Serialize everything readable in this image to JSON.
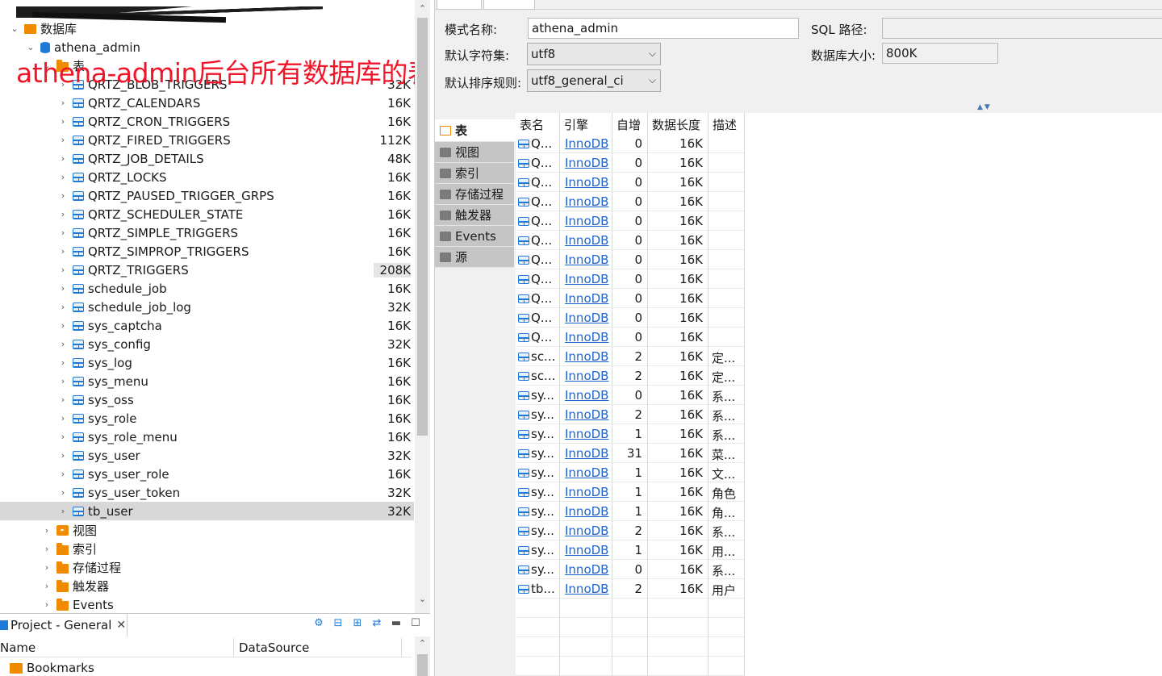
{
  "tree": {
    "root_label": "数据库",
    "schema_label": "athena_admin",
    "tables_folder_label": "表",
    "tables": [
      {
        "name": "QRTZ_BLOB_TRIGGERS",
        "size": "32K"
      },
      {
        "name": "QRTZ_CALENDARS",
        "size": "16K"
      },
      {
        "name": "QRTZ_CRON_TRIGGERS",
        "size": "16K"
      },
      {
        "name": "QRTZ_FIRED_TRIGGERS",
        "size": "112K"
      },
      {
        "name": "QRTZ_JOB_DETAILS",
        "size": "48K"
      },
      {
        "name": "QRTZ_LOCKS",
        "size": "16K"
      },
      {
        "name": "QRTZ_PAUSED_TRIGGER_GRPS",
        "size": "16K"
      },
      {
        "name": "QRTZ_SCHEDULER_STATE",
        "size": "16K"
      },
      {
        "name": "QRTZ_SIMPLE_TRIGGERS",
        "size": "16K"
      },
      {
        "name": "QRTZ_SIMPROP_TRIGGERS",
        "size": "16K"
      },
      {
        "name": "QRTZ_TRIGGERS",
        "size": "208K"
      },
      {
        "name": "schedule_job",
        "size": "16K"
      },
      {
        "name": "schedule_job_log",
        "size": "32K"
      },
      {
        "name": "sys_captcha",
        "size": "16K"
      },
      {
        "name": "sys_config",
        "size": "32K"
      },
      {
        "name": "sys_log",
        "size": "16K"
      },
      {
        "name": "sys_menu",
        "size": "16K"
      },
      {
        "name": "sys_oss",
        "size": "16K"
      },
      {
        "name": "sys_role",
        "size": "16K"
      },
      {
        "name": "sys_role_menu",
        "size": "16K"
      },
      {
        "name": "sys_user",
        "size": "32K"
      },
      {
        "name": "sys_user_role",
        "size": "16K"
      },
      {
        "name": "sys_user_token",
        "size": "32K"
      },
      {
        "name": "tb_user",
        "size": "32K"
      }
    ],
    "other_folders": [
      "视图",
      "索引",
      "存储过程",
      "触发器",
      "Events"
    ]
  },
  "annotation": "athena-admin后台所有数据库的表",
  "project_panel": {
    "tab_label": "Project - General",
    "col_name": "Name",
    "col_datasource": "DataSource",
    "row_bookmarks": "Bookmarks"
  },
  "properties": {
    "schema_name_label": "模式名称:",
    "schema_name_value": "athena_admin",
    "sql_path_label": "SQL 路径:",
    "sql_path_value": "",
    "charset_label": "默认字符集:",
    "charset_value": "utf8",
    "db_size_label": "数据库大小:",
    "db_size_value": "800K",
    "collation_label": "默认排序规则:",
    "collation_value": "utf8_general_ci"
  },
  "vtabs": [
    "表",
    "视图",
    "索引",
    "存储过程",
    "触发器",
    "Events",
    "源"
  ],
  "table_grid": {
    "headers": [
      "表名",
      "引擎",
      "自增",
      "数据长度",
      "描述"
    ],
    "rows": [
      {
        "name": "Q...",
        "engine": "InnoDB",
        "auto": "0",
        "len": "16K",
        "desc": ""
      },
      {
        "name": "Q...",
        "engine": "InnoDB",
        "auto": "0",
        "len": "16K",
        "desc": ""
      },
      {
        "name": "Q...",
        "engine": "InnoDB",
        "auto": "0",
        "len": "16K",
        "desc": ""
      },
      {
        "name": "Q...",
        "engine": "InnoDB",
        "auto": "0",
        "len": "16K",
        "desc": ""
      },
      {
        "name": "Q...",
        "engine": "InnoDB",
        "auto": "0",
        "len": "16K",
        "desc": ""
      },
      {
        "name": "Q...",
        "engine": "InnoDB",
        "auto": "0",
        "len": "16K",
        "desc": ""
      },
      {
        "name": "Q...",
        "engine": "InnoDB",
        "auto": "0",
        "len": "16K",
        "desc": ""
      },
      {
        "name": "Q...",
        "engine": "InnoDB",
        "auto": "0",
        "len": "16K",
        "desc": ""
      },
      {
        "name": "Q...",
        "engine": "InnoDB",
        "auto": "0",
        "len": "16K",
        "desc": ""
      },
      {
        "name": "Q...",
        "engine": "InnoDB",
        "auto": "0",
        "len": "16K",
        "desc": ""
      },
      {
        "name": "Q...",
        "engine": "InnoDB",
        "auto": "0",
        "len": "16K",
        "desc": ""
      },
      {
        "name": "sc...",
        "engine": "InnoDB",
        "auto": "2",
        "len": "16K",
        "desc": "定..."
      },
      {
        "name": "sc...",
        "engine": "InnoDB",
        "auto": "2",
        "len": "16K",
        "desc": "定..."
      },
      {
        "name": "sy...",
        "engine": "InnoDB",
        "auto": "0",
        "len": "16K",
        "desc": "系..."
      },
      {
        "name": "sy...",
        "engine": "InnoDB",
        "auto": "2",
        "len": "16K",
        "desc": "系..."
      },
      {
        "name": "sy...",
        "engine": "InnoDB",
        "auto": "1",
        "len": "16K",
        "desc": "系..."
      },
      {
        "name": "sy...",
        "engine": "InnoDB",
        "auto": "31",
        "len": "16K",
        "desc": "菜..."
      },
      {
        "name": "sy...",
        "engine": "InnoDB",
        "auto": "1",
        "len": "16K",
        "desc": "文..."
      },
      {
        "name": "sy...",
        "engine": "InnoDB",
        "auto": "1",
        "len": "16K",
        "desc": "角色"
      },
      {
        "name": "sy...",
        "engine": "InnoDB",
        "auto": "1",
        "len": "16K",
        "desc": "角..."
      },
      {
        "name": "sy...",
        "engine": "InnoDB",
        "auto": "2",
        "len": "16K",
        "desc": "系..."
      },
      {
        "name": "sy...",
        "engine": "InnoDB",
        "auto": "1",
        "len": "16K",
        "desc": "用..."
      },
      {
        "name": "sy...",
        "engine": "InnoDB",
        "auto": "0",
        "len": "16K",
        "desc": "系..."
      },
      {
        "name": "tb...",
        "engine": "InnoDB",
        "auto": "2",
        "len": "16K",
        "desc": "用户"
      }
    ]
  }
}
